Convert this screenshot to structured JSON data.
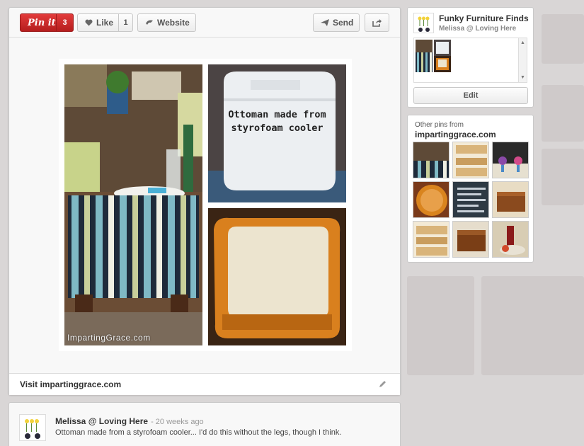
{
  "pin_toolbar": {
    "pinit_label": "Pin it",
    "pinit_count": "3",
    "like_label": "Like",
    "like_count": "1",
    "website_label": "Website",
    "send_label": "Send"
  },
  "pin_image": {
    "caption_line1": "Ottoman made from",
    "caption_line2": "styrofoam cooler",
    "watermark": "ImpartingGrace.com"
  },
  "visit_link": "Visit impartinggrace.com",
  "comment": {
    "author": "Melissa @ Loving Here",
    "time": "- 20 weeks ago",
    "text": "Ottoman made from a styrofoam cooler... I'd do this without the legs, though I think."
  },
  "board": {
    "title": "Funky Furniture Finds",
    "owner": "Melissa @ Loving Here",
    "edit_label": "Edit"
  },
  "other_pins": {
    "label": "Other pins from",
    "site": "impartinggrace.com"
  },
  "icons": {
    "heart": "heart-icon",
    "website": "website-icon",
    "send": "send-icon",
    "share": "share-icon",
    "pencil": "pencil-icon"
  },
  "colors": {
    "pinit_red": "#c8232c",
    "panel_bg": "#f8f8f8",
    "overlay_bg": "#d7d4d4"
  }
}
